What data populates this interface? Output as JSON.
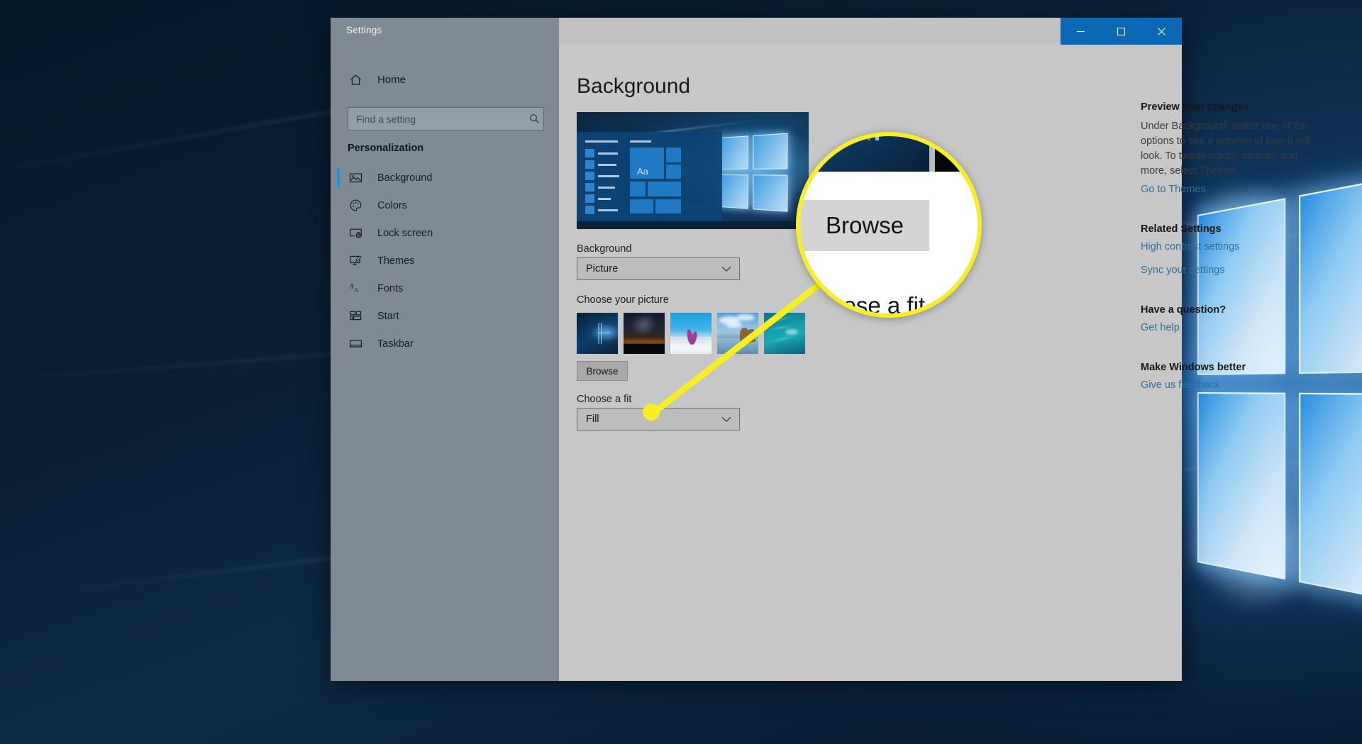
{
  "window": {
    "app_title": "Settings",
    "controls": [
      {
        "name": "minimize",
        "label": "–"
      },
      {
        "name": "maximize",
        "label": "□"
      },
      {
        "name": "close",
        "label": "✕"
      }
    ]
  },
  "sidebar": {
    "home_label": "Home",
    "home_icon": "home-icon",
    "search": {
      "placeholder": "Find a setting",
      "value": "",
      "icon": "search-icon"
    },
    "section_title": "Personalization",
    "items": [
      {
        "label": "Background",
        "icon": "picture-icon",
        "selected": true
      },
      {
        "label": "Colors",
        "icon": "palette-icon",
        "selected": false
      },
      {
        "label": "Lock screen",
        "icon": "lock-screen-icon",
        "selected": false
      },
      {
        "label": "Themes",
        "icon": "themes-icon",
        "selected": false
      },
      {
        "label": "Fonts",
        "icon": "fonts-icon",
        "selected": false
      },
      {
        "label": "Start",
        "icon": "start-tiles-icon",
        "selected": false
      },
      {
        "label": "Taskbar",
        "icon": "taskbar-icon",
        "selected": false
      }
    ]
  },
  "main": {
    "page_title": "Background",
    "preview_alt": "Aa",
    "background_label": "Background",
    "background_value": "Picture",
    "choose_picture_label": "Choose your picture",
    "thumbnails": [
      {
        "name": "windows-hero-thumbnail",
        "alt": "Windows 10 hero wallpaper"
      },
      {
        "name": "night-sky-thumbnail",
        "alt": "Night sky over dark landscape"
      },
      {
        "name": "crocus-snow-thumbnail",
        "alt": "Purple crocus in snow"
      },
      {
        "name": "beach-rock-thumbnail",
        "alt": "Beach with sea rock"
      },
      {
        "name": "underwater-thumbnail",
        "alt": "Underwater swimmer"
      }
    ],
    "browse_label": "Browse",
    "choose_fit_label": "Choose a fit",
    "fit_value": "Fill"
  },
  "info_panel": [
    {
      "heading": "Preview your changes",
      "paragraph": "Under Background, select one of the options to see a preview of how it will look. To tweak colors, sounds, and more, select Themes.",
      "links": [
        "Go to Themes"
      ]
    },
    {
      "heading": "Related Settings",
      "paragraph": "",
      "links": [
        "High contrast settings",
        "Sync your settings"
      ]
    },
    {
      "heading": "Have a question?",
      "paragraph": "",
      "links": [
        "Get help"
      ]
    },
    {
      "heading": "Make Windows better",
      "paragraph": "",
      "links": [
        "Give us feedback"
      ]
    }
  ],
  "callout": {
    "magnified_browse_label": "Browse",
    "magnified_fit_label": "Choose a fit",
    "highlight_color": "#f9ee21"
  },
  "colors": {
    "accent_blue": "#1b94e8",
    "titlebar_button_blue": "#0a68b5",
    "sidebar_gray": "#7f8a94",
    "content_gray": "#c7c7c7",
    "link_blue": "#2c6f9b",
    "callout_yellow": "#f9ee21"
  }
}
